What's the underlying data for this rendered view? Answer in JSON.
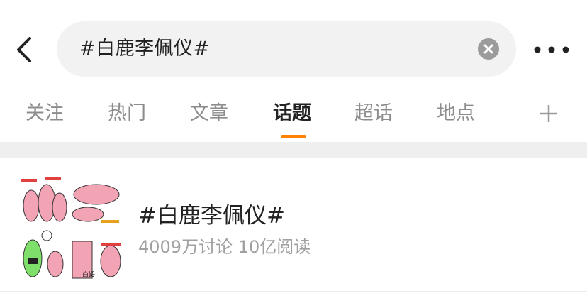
{
  "search": {
    "query": "#白鹿李佩仪#"
  },
  "tabs": [
    {
      "label": "关注"
    },
    {
      "label": "热门"
    },
    {
      "label": "文章"
    },
    {
      "label": "话题"
    },
    {
      "label": "超话"
    },
    {
      "label": "地点"
    }
  ],
  "active_tab": "话题",
  "accent_color": "#ff8200",
  "result": {
    "title": "#白鹿李佩仪#",
    "meta": "4009万讨论 10亿阅读",
    "thumbnail_labels": [
      "白媛"
    ]
  },
  "icons": {
    "back": "back-arrow-icon",
    "clear": "clear-icon",
    "more": "more-dots-icon",
    "add": "plus-icon"
  }
}
